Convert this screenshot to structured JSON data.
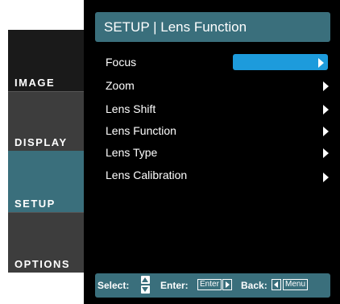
{
  "sidebar": {
    "tabs": [
      {
        "label": "IMAGE"
      },
      {
        "label": "DISPLAY"
      },
      {
        "label": "SETUP",
        "active": true
      },
      {
        "label": "OPTIONS"
      }
    ]
  },
  "header": {
    "title": "SETUP | Lens Function"
  },
  "menu": {
    "items": [
      {
        "label": "Focus",
        "selected": true
      },
      {
        "label": "Zoom"
      },
      {
        "label": "Lens Shift"
      },
      {
        "label": "Lens Function"
      },
      {
        "label": "Lens Type"
      },
      {
        "label": "Lens Calibration"
      }
    ]
  },
  "helpbar": {
    "select_label": "Select:",
    "enter_label": "Enter:",
    "enter_key": "Enter",
    "back_label": "Back:",
    "back_key": "Menu"
  },
  "colors": {
    "accent": "#3a6f7c",
    "highlight": "#1d9bdc",
    "panel": "#000000"
  }
}
